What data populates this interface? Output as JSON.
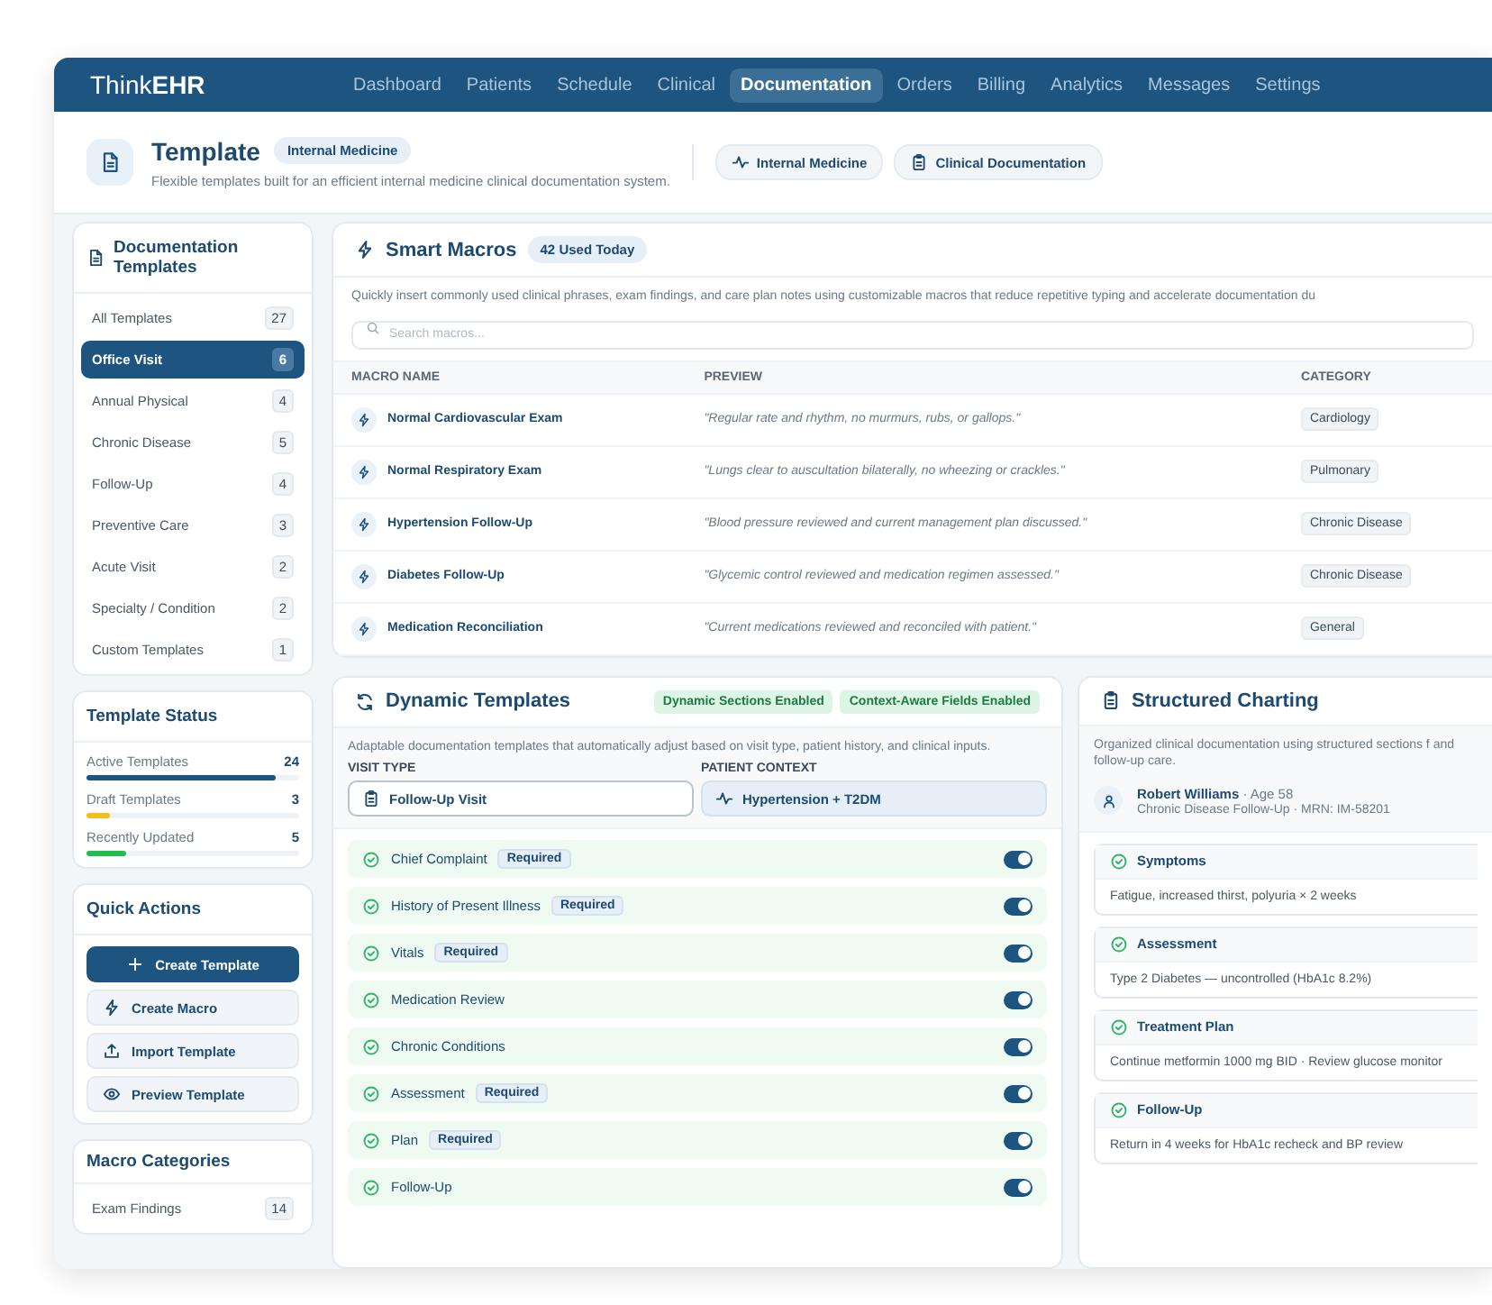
{
  "brand": {
    "light": "Think",
    "bold": "EHR"
  },
  "nav": [
    {
      "label": "Dashboard",
      "selected": false
    },
    {
      "label": "Patients",
      "selected": false
    },
    {
      "label": "Schedule",
      "selected": false
    },
    {
      "label": "Clinical",
      "selected": false
    },
    {
      "label": "Documentation",
      "selected": true
    },
    {
      "label": "Orders",
      "selected": false
    },
    {
      "label": "Billing",
      "selected": false
    },
    {
      "label": "Analytics",
      "selected": false
    },
    {
      "label": "Messages",
      "selected": false
    },
    {
      "label": "Settings",
      "selected": false
    }
  ],
  "header": {
    "title": "Template",
    "badge": "Internal Medicine",
    "subtitle": "Flexible templates built for an efficient internal medicine clinical documentation system.",
    "chips": [
      {
        "label": "Internal Medicine"
      },
      {
        "label": "Clinical Documentation"
      }
    ]
  },
  "sidebar": {
    "title": "Documentation Templates",
    "items": [
      {
        "label": "All Templates",
        "count": "27",
        "selected": false
      },
      {
        "label": "Office Visit",
        "count": "6",
        "selected": true
      },
      {
        "label": "Annual Physical",
        "count": "4",
        "selected": false
      },
      {
        "label": "Chronic Disease",
        "count": "5",
        "selected": false
      },
      {
        "label": "Follow-Up",
        "count": "4",
        "selected": false
      },
      {
        "label": "Preventive Care",
        "count": "3",
        "selected": false
      },
      {
        "label": "Acute Visit",
        "count": "2",
        "selected": false
      },
      {
        "label": "Specialty / Condition",
        "count": "2",
        "selected": false
      },
      {
        "label": "Custom Templates",
        "count": "1",
        "selected": false
      }
    ]
  },
  "template_status": {
    "title": "Template Status",
    "items": [
      {
        "label": "Active Templates",
        "value": "24",
        "level": 0.89,
        "color": "#1d5580"
      },
      {
        "label": "Draft Templates",
        "value": "3",
        "level": 0.11,
        "color": "#f2bd1d"
      },
      {
        "label": "Recently Updated",
        "value": "5",
        "level": 0.19,
        "color": "#1fbf4f"
      }
    ]
  },
  "quick_actions": {
    "title": "Quick Actions",
    "items": [
      {
        "label": "Create Template",
        "kind": "primary"
      },
      {
        "label": "Create Macro",
        "kind": "secondary"
      },
      {
        "label": "Import Template",
        "kind": "secondary"
      },
      {
        "label": "Preview Template",
        "kind": "secondary"
      }
    ]
  },
  "macro_categories": {
    "title": "Macro Categories",
    "items": [
      {
        "label": "Exam Findings",
        "count": "14"
      }
    ]
  },
  "smart_macros": {
    "title": "Smart Macros",
    "badge": "42 Used Today",
    "description": "Quickly insert commonly used clinical phrases, exam findings, and care plan notes using customizable macros that reduce repetitive typing and accelerate documentation du",
    "search": {
      "placeholder": "Search macros..."
    },
    "columns": [
      "MACRO NAME",
      "PREVIEW",
      "CATEGORY"
    ],
    "rows": [
      {
        "name": "Normal Cardiovascular Exam",
        "preview": "\"Regular rate and rhythm, no murmurs, rubs, or gallops.\"",
        "category": "Cardiology"
      },
      {
        "name": "Normal Respiratory Exam",
        "preview": "\"Lungs clear to auscultation bilaterally, no wheezing or crackles.\"",
        "category": "Pulmonary"
      },
      {
        "name": "Hypertension Follow-Up",
        "preview": "\"Blood pressure reviewed and current management plan discussed.\"",
        "category": "Chronic Disease"
      },
      {
        "name": "Diabetes Follow-Up",
        "preview": "\"Glycemic control reviewed and medication regimen assessed.\"",
        "category": "Chronic Disease"
      },
      {
        "name": "Medication Reconciliation",
        "preview": "\"Current medications reviewed and reconciled with patient.\"",
        "category": "General"
      }
    ]
  },
  "dynamic_templates": {
    "title": "Dynamic Templates",
    "tags": [
      "Dynamic Sections Enabled",
      "Context-Aware Fields Enabled"
    ],
    "description": "Adaptable documentation templates that automatically adjust based on visit type, patient history, and clinical inputs.",
    "visit_type": {
      "label": "VISIT TYPE",
      "value": "Follow-Up Visit"
    },
    "patient_context": {
      "label": "PATIENT CONTEXT",
      "value": "Hypertension + T2DM"
    },
    "sections": [
      {
        "label": "Chief Complaint",
        "required": "Required",
        "on": true
      },
      {
        "label": "History of Present Illness",
        "required": "Required",
        "on": true
      },
      {
        "label": "Vitals",
        "required": "Required",
        "on": true
      },
      {
        "label": "Medication Review",
        "on": true
      },
      {
        "label": "Chronic Conditions",
        "on": true
      },
      {
        "label": "Assessment",
        "required": "Required",
        "on": true
      },
      {
        "label": "Plan",
        "required": "Required",
        "on": true
      },
      {
        "label": "Follow-Up",
        "on": true
      }
    ]
  },
  "structured_charting": {
    "title": "Structured Charting",
    "description": "Organized clinical documentation using structured sections f and follow-up care.",
    "patient": {
      "name": "Robert Williams",
      "age": "· Age 58",
      "details": "Chronic Disease Follow-Up · MRN: IM-58201"
    },
    "sections": [
      {
        "title": "Symptoms",
        "body": "Fatigue, increased thirst, polyuria × 2 weeks"
      },
      {
        "title": "Assessment",
        "body": "Type 2 Diabetes — uncontrolled (HbA1c 8.2%)"
      },
      {
        "title": "Treatment Plan",
        "body": "Continue metformin 1000 mg BID · Review glucose monitor"
      },
      {
        "title": "Follow-Up",
        "body": "Return in 4 weeks for HbA1c recheck and BP review"
      }
    ]
  }
}
